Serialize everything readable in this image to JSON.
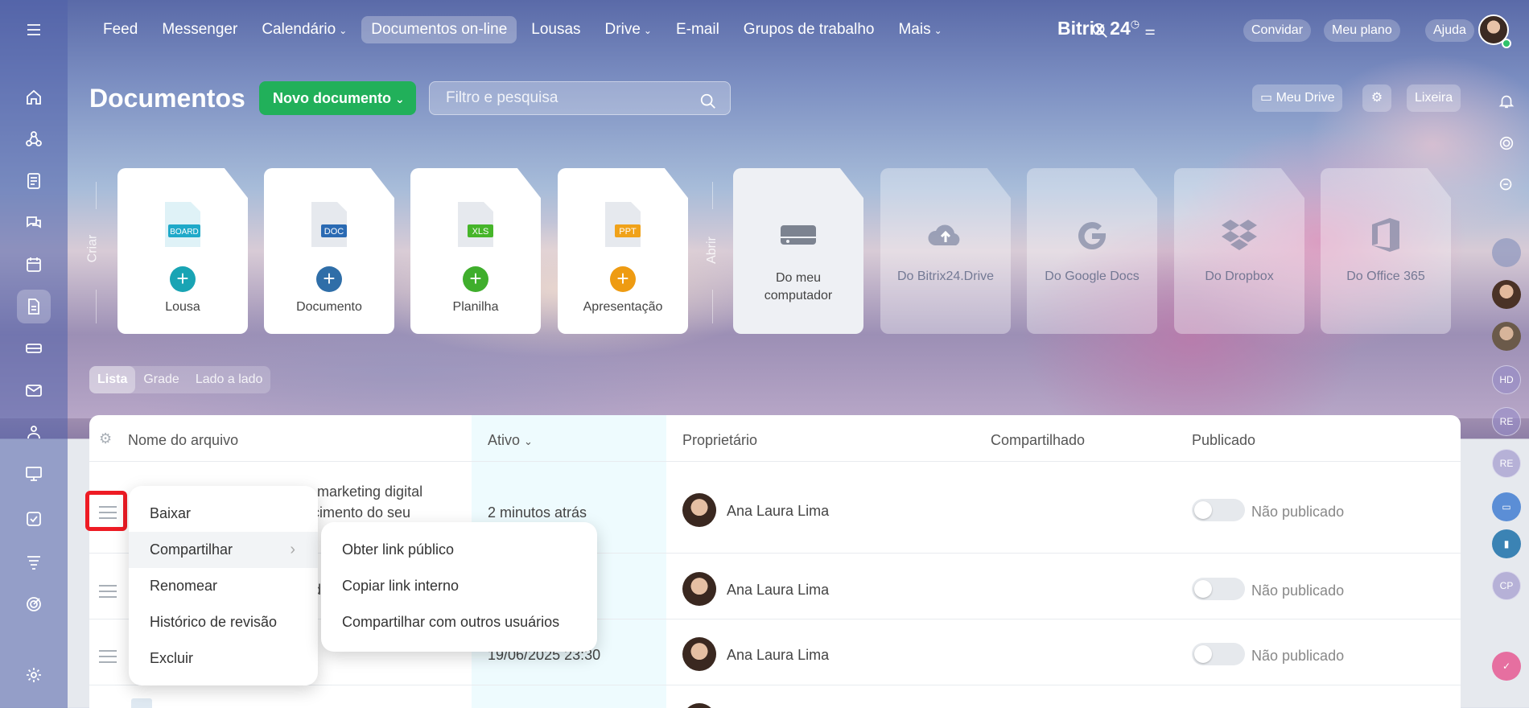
{
  "top_nav": {
    "items": [
      {
        "label": "Feed",
        "caret": false
      },
      {
        "label": "Messenger",
        "caret": false
      },
      {
        "label": "Calendário",
        "caret": true
      },
      {
        "label": "Documentos on-line",
        "caret": false,
        "active": true
      },
      {
        "label": "Lousas",
        "caret": false
      },
      {
        "label": "Drive",
        "caret": true
      },
      {
        "label": "E-mail",
        "caret": false
      },
      {
        "label": "Grupos de trabalho",
        "caret": false
      },
      {
        "label": "Mais",
        "caret": true
      }
    ],
    "brand": "Bitrix 24",
    "invite": "Convidar",
    "my_plan": "Meu plano",
    "help": "Ajuda"
  },
  "page": {
    "title": "Documentos",
    "new_doc": "Novo documento",
    "search_placeholder": "Filtro e pesquisa",
    "my_drive": "Meu Drive",
    "trash": "Lixeira"
  },
  "create": {
    "section_label": "Criar",
    "tiles": [
      {
        "label": "Lousa",
        "badge": "BOARD",
        "color": "#1fa9c9",
        "plus_color": "#19a4b4"
      },
      {
        "label": "Documento",
        "badge": "DOC",
        "color": "#2a6ab3",
        "plus_color": "#2f6ea8"
      },
      {
        "label": "Planilha",
        "badge": "XLS",
        "color": "#46b52a",
        "plus_color": "#3fae2c"
      },
      {
        "label": "Apresentação",
        "badge": "PPT",
        "color": "#f0a21a",
        "plus_color": "#ee9b12"
      }
    ]
  },
  "open": {
    "section_label": "Abrir",
    "tiles": [
      {
        "label": "Do meu computador"
      },
      {
        "label": "Do Bitrix24.Drive"
      },
      {
        "label": "Do Google Docs"
      },
      {
        "label": "Do Dropbox"
      },
      {
        "label": "Do Office 365"
      }
    ]
  },
  "views": [
    "Lista",
    "Grade",
    "Lado a lado"
  ],
  "table": {
    "headers": {
      "name": "Nome do arquivo",
      "active": "Ativo",
      "owner": "Proprietário",
      "shared": "Compartilhado",
      "published": "Publicado"
    },
    "rows": [
      {
        "name_line1": "e marketing digital",
        "name_line2": "scimento do seu",
        "active": "2 minutos atrás",
        "owner": "Ana Laura Lima",
        "published": "Não publicado"
      },
      {
        "name_line1": "d",
        "name_line2": "",
        "active": "",
        "owner": "Ana Laura Lima",
        "published": "Não publicado"
      },
      {
        "name_line1": "",
        "name_line2": "",
        "active": "19/06/2025 23:30",
        "owner": "Ana Laura Lima",
        "published": "Não publicado"
      }
    ]
  },
  "context_menu": {
    "items": [
      "Baixar",
      "Compartilhar",
      "Renomear",
      "Histórico de revisão",
      "Excluir"
    ]
  },
  "share_submenu": {
    "items": [
      "Obter link público",
      "Copiar link interno",
      "Compartilhar com outros usuários"
    ]
  },
  "right_bar": {
    "initials": [
      "HD",
      "RE",
      "RE",
      "CP"
    ]
  }
}
